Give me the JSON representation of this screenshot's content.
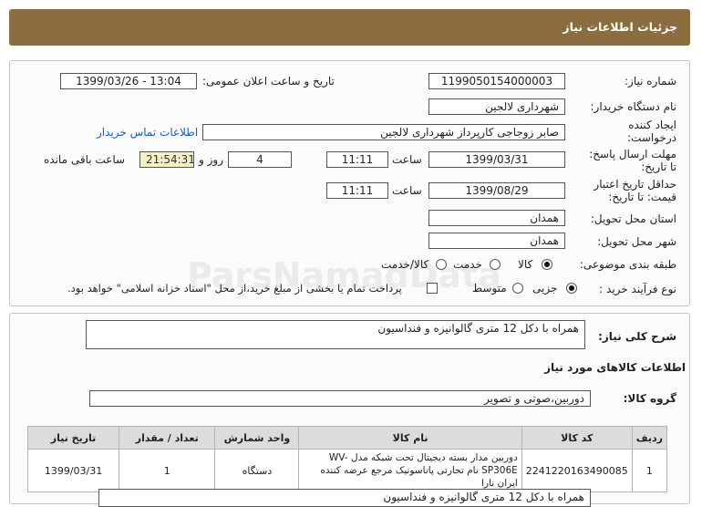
{
  "page_title": "جزئیات اطلاعات نیاز",
  "labels": {
    "need_number": "شماره نیاز:",
    "announce_datetime": "تاریخ و ساعت اعلان عمومی:",
    "buyer_org": "نام دستگاه خریدار:",
    "requester_l1": "ایجاد کننده",
    "requester_l2": "درخواست:",
    "contact_link": "اطلاعات تماس خریدار",
    "deadline_l1": "مهلت ارسال پاسخ:",
    "deadline_l2": "تا تاریخ:",
    "time": "ساعت",
    "day_and": "روز و",
    "remaining": "ساعت باقی مانده",
    "validity_l1": "حداقل تاریخ اعتبار",
    "validity_l2": "قیمت: تا تاریخ:",
    "province": "استان محل تحویل:",
    "city": "شهر محل تحویل:",
    "category": "طبقه بندی موضوعی:",
    "process": "نوع فرآیند خرید :",
    "description": "شرح کلی نیاز:",
    "items_info": "اطلاعات کالاهای مورد نیاز",
    "goods_group": "گروه کالا:"
  },
  "values": {
    "need_number": "1199050154000003",
    "announce_datetime": "1399/03/26 - 13:04",
    "buyer_org": "شهرداری لالجین",
    "requester": "صابر زوجاجی کارپرداز شهرداری لالجین",
    "deadline_date": "1399/03/31",
    "deadline_time": "11:11",
    "days": "4",
    "remaining_time": "21:54:31",
    "validity_date": "1399/08/29",
    "validity_time": "11:11",
    "province": "همدان",
    "city": "همدان",
    "description": "همراه با دکل 12 متری گالوانیزه و فنداسیون",
    "goods_group": "دوربین،صوتی و تصویر",
    "bottom_note": "همراه با دکل 12 متری گالوانیزه و فنداسیون"
  },
  "category_options": [
    {
      "label": "کالا",
      "selected": true
    },
    {
      "label": "خدمت",
      "selected": false
    },
    {
      "label": "کالا/خدمت",
      "selected": false
    }
  ],
  "process_options": [
    {
      "label": "جزیی",
      "selected": true
    },
    {
      "label": "متوسط",
      "selected": false
    }
  ],
  "payment_note": "پرداخت تمام یا بخشی از مبلغ خرید،از محل \"اسناد خزانه اسلامی\" خواهد بود.",
  "table": {
    "headers": [
      "ردیف",
      "کد کالا",
      "نام کالا",
      "واحد شمارش",
      "تعداد / مقدار",
      "تاریخ نیاز"
    ],
    "rows": [
      [
        "1",
        "2241220163490085",
        "دوربین مدار بسته دیجیتال تحت شبکه مدل WV-SP306E نام تجارتی پاناسونیک مرجع عرضه کننده ایران نارا",
        "دستگاه",
        "1",
        "1399/03/31"
      ]
    ]
  },
  "watermark": {
    "line1": "ParsNamadData",
    "line2": "پایگاه اطلاع رسانی مناقصه و مزایده",
    "line3": "۰۲۱-۸۸۳۴۹۶۷۰-۵"
  },
  "colors": {
    "header_bg": "#8b6d3f",
    "remaining_bg": "#f5f1c4",
    "link": "#1a5fb4"
  }
}
